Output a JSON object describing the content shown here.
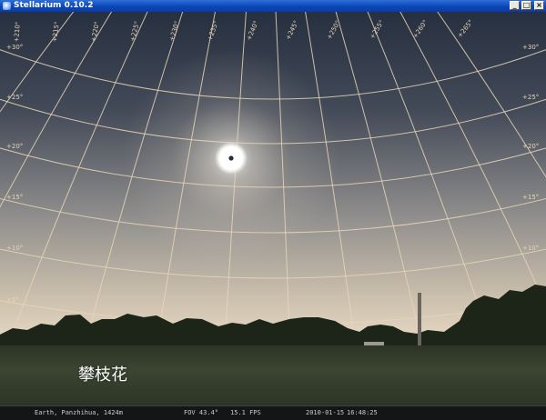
{
  "window": {
    "title": "Stellarium 0.10.2",
    "buttons": {
      "minimize": "_",
      "maximize": "□",
      "close": "×"
    }
  },
  "sky": {
    "landscape_name": "攀枝花",
    "altitude_labels": [
      "+5°",
      "+10°",
      "+15°",
      "+20°",
      "+25°",
      "+30°"
    ],
    "azimuth_labels": [
      "+210°",
      "+215°",
      "+220°",
      "+225°",
      "+230°",
      "+235°",
      "+240°",
      "+245°",
      "+250°",
      "+255°",
      "+260°",
      "+265°"
    ],
    "colors": {
      "sky_top": "#293241",
      "sky_horizon": "#e9dcc6",
      "grid": "#e7d6b7",
      "sun_glow": "#ffffff",
      "ground": "#3b4531"
    }
  },
  "status": {
    "location": "Earth, Panzhihua, 1424m",
    "fov": "FOV 43.4°",
    "fps": "15.1 FPS",
    "date": "2010-01-15",
    "time": "16:48:25"
  }
}
